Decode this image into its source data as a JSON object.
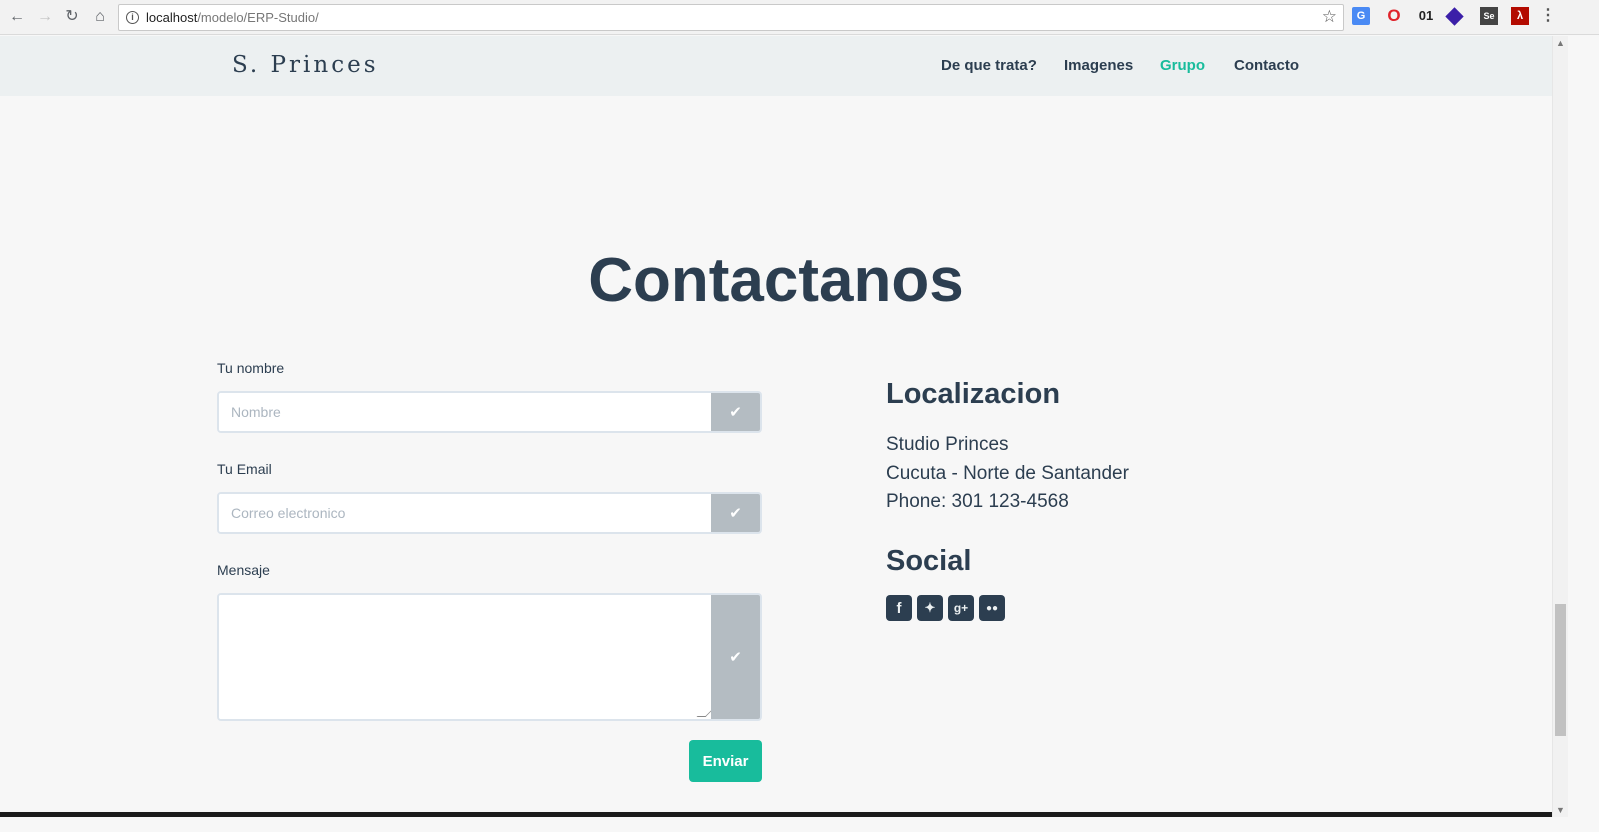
{
  "browser": {
    "url_host": "localhost",
    "url_path": "/modelo/ERP-Studio/",
    "extension_01": "01",
    "extension_se": "Se"
  },
  "navbar": {
    "brand": "S. Princes",
    "links": [
      "De que trata?",
      "Imagenes",
      "Grupo",
      "Contacto"
    ],
    "active_link": "Grupo"
  },
  "section_title": "Contactanos",
  "form": {
    "name_label": "Tu nombre",
    "name_placeholder": "Nombre",
    "email_label": "Tu Email",
    "email_placeholder": "Correo electronico",
    "message_label": "Mensaje",
    "submit_label": "Enviar"
  },
  "location": {
    "heading": "Localizacion",
    "lines": [
      "Studio Princes",
      "Cucuta - Norte de Santander",
      "Phone: 301 123-4568"
    ]
  },
  "social": {
    "heading": "Social",
    "icons": [
      "facebook-icon",
      "twitter-icon",
      "google-plus-icon",
      "flickr-icon"
    ]
  },
  "colors": {
    "primary": "#2c3e50",
    "accent": "#18bc9c",
    "addon": "#b4bcc2"
  }
}
